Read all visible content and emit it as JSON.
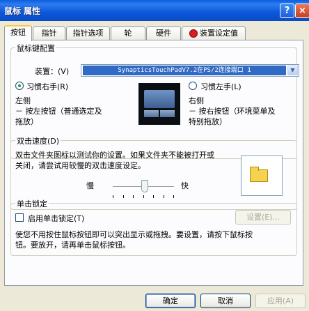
{
  "window": {
    "title": "鼠标 属性",
    "help": "?",
    "close": "×"
  },
  "tabs": [
    {
      "label": "按钮"
    },
    {
      "label": "指针"
    },
    {
      "label": "指针选项"
    },
    {
      "label": "轮"
    },
    {
      "label": "硬件"
    },
    {
      "label": "装置设定值"
    }
  ],
  "button_config": {
    "legend": "鼠标键配置",
    "device_label": "装置：(V)",
    "device_value": "SynapticsTouchPadV7.2在PS/2连接端口 1",
    "right_hand_label": "习惯右手(R)",
    "left_hand_label": "习惯左手(L)",
    "left_side": "左侧",
    "left_desc_1": "－ 按左按钮（普通选定及",
    "left_desc_2": "拖放）",
    "right_side": "右侧",
    "right_desc_1": "－ 按右按钮（环境菜单及",
    "right_desc_2": "特别拖放）",
    "selected": "right_hand"
  },
  "double_click": {
    "legend": "双击速度(D)",
    "desc_1": "双击文件夹图标以测试你的设置。如果文件夹不能被打开或",
    "desc_2": "关闭，请尝试用较慢的双击速度设定。",
    "slow": "慢",
    "fast": "快",
    "speed_fraction": 0.5
  },
  "click_lock": {
    "legend": "单击锁定",
    "enable_label": "启用单击锁定(T)",
    "enabled": false,
    "settings_button": "设置(E)...",
    "desc_1": "使您不用按住鼠标按钮即可以突出显示或拖拽。要设置，请按下鼠标按",
    "desc_2": "钮。要放开，请再单击鼠标按钮。"
  },
  "footer": {
    "ok": "确定",
    "cancel": "取消",
    "apply": "应用(A)"
  }
}
